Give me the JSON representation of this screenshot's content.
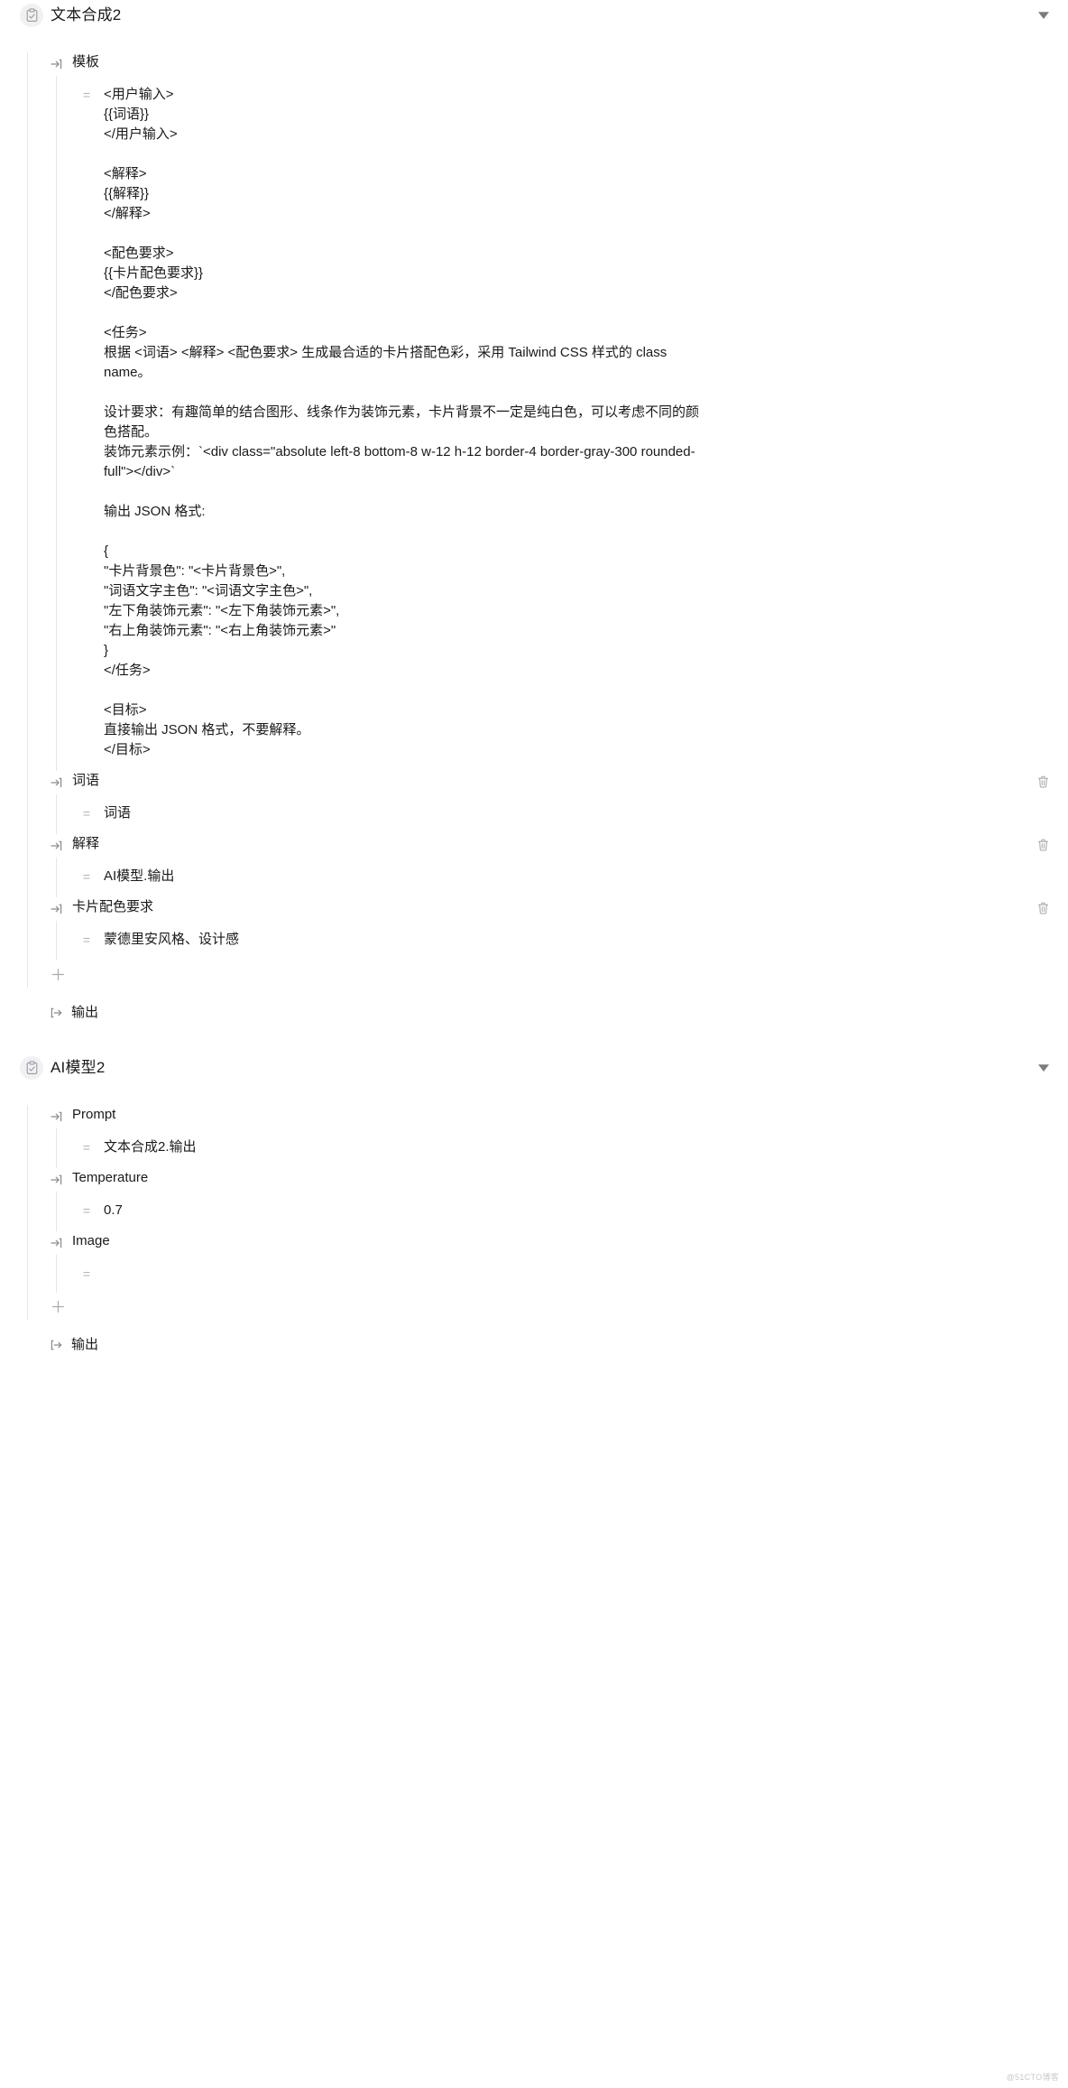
{
  "nodes": [
    {
      "id": "text-composer-2",
      "icon": "clipboard-check-icon",
      "title": "文本合成2",
      "collapse_icon": "triangle-down-icon",
      "fields": [
        {
          "label": "模板",
          "value": "<用户输入>\n{{词语}}\n</用户输入>\n\n<解释>\n{{解释}}\n</解释>\n\n<配色要求>\n{{卡片配色要求}}\n</配色要求>\n\n<任务>\n根据 <词语> <解释> <配色要求> 生成最合适的卡片搭配色彩，采用 Tailwind CSS 样式的 class name。\n\n设计要求：有趣简单的结合图形、线条作为装饰元素，卡片背景不一定是纯白色，可以考虑不同的颜色搭配。\n装饰元素示例：`<div class=\"absolute left-8 bottom-8 w-12 h-12 border-4 border-gray-300 rounded-full\"></div>`\n\n输出 JSON 格式:\n\n{\n\"卡片背景色\": \"<卡片背景色>\",\n\"词语文字主色\": \"<词语文字主色>\",\n\"左下角装饰元素\": \"<左下角装饰元素>\",\n\"右上角装饰元素\": \"<右上角装饰元素>\"\n}\n</任务>\n\n<目标>\n直接输出 JSON 格式，不要解释。\n</目标>",
          "deletable": false
        },
        {
          "label": "词语",
          "value": "词语",
          "deletable": true,
          "delete_icon": "trash-icon"
        },
        {
          "label": "解释",
          "value": "AI模型.输出",
          "deletable": true,
          "delete_icon": "trash-icon"
        },
        {
          "label": "卡片配色要求",
          "value": "蒙德里安风格、设计感",
          "deletable": true,
          "delete_icon": "trash-icon"
        }
      ],
      "add_icon": "plus-icon",
      "output": {
        "icon": "arrow-out-icon",
        "label": "输出"
      }
    },
    {
      "id": "ai-model-2",
      "icon": "clipboard-check-icon",
      "title": "AI模型2",
      "collapse_icon": "triangle-down-icon",
      "fields": [
        {
          "label": "Prompt",
          "value": "文本合成2.输出",
          "deletable": false
        },
        {
          "label": "Temperature",
          "value": "0.7",
          "deletable": false
        },
        {
          "label": "Image",
          "value": "",
          "deletable": false
        }
      ],
      "add_icon": "plus-icon",
      "output": {
        "icon": "arrow-out-icon",
        "label": "输出"
      }
    }
  ],
  "field_icons": {
    "input": "arrow-in-icon",
    "equals": "equals-icon"
  },
  "watermark": "@51CTO博客",
  "colors": {
    "rail": "#e6e6e8",
    "icon_muted": "#8a8a90",
    "text": "#1a1a1a",
    "icon_bg": "#f1f1f3"
  }
}
